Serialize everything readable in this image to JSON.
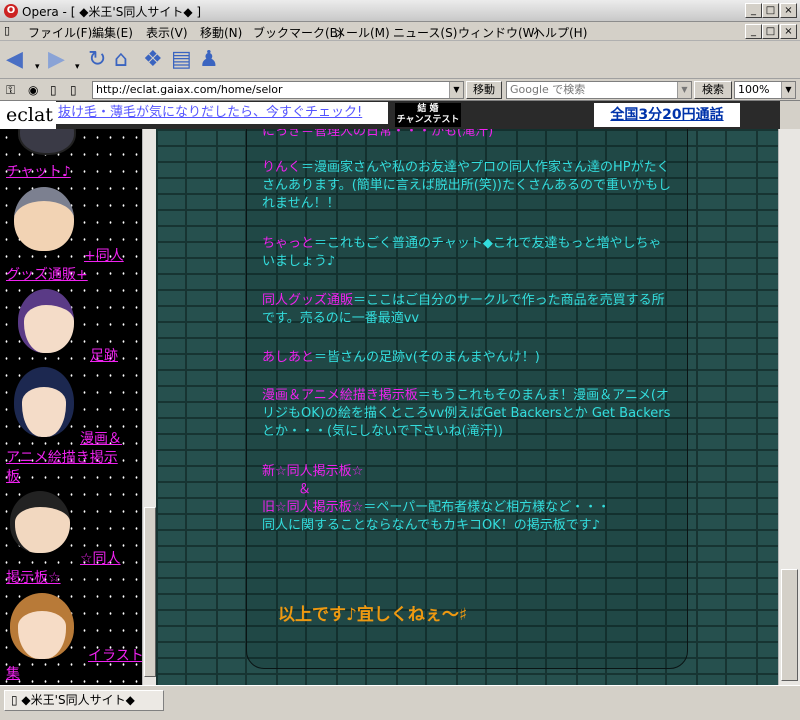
{
  "window": {
    "title": "Opera - [ ◆米王'S同人サイト◆ ]",
    "minimize": "_",
    "maximize": "□",
    "close": "×"
  },
  "menu": [
    "ファイル(F)",
    "編集(E)",
    "表示(V)",
    "移動(N)",
    "ブックマーク(B)",
    "メール(M)",
    "ニュース(S)",
    "ウィンドウ(W)",
    "ヘルプ(H)"
  ],
  "address": {
    "url": "http://eclat.gaiax.com/home/selor",
    "go_label": "移動",
    "search_placeholder": "Google で検索",
    "search_button": "検索",
    "zoom": "100%"
  },
  "ad": {
    "logo": "eclat",
    "text": "抜け毛・薄毛が気になりだしたら、今すぐチェック!",
    "badge_line1": "結  婚",
    "badge_line2": "チャンステスト",
    "call": "全国3分20円通話"
  },
  "sidebar": {
    "links": [
      "チャット♪",
      "+同人",
      "グッズ通販+",
      "足跡",
      "漫画＆",
      "アニメ絵描き掲示",
      "板",
      "☆同人",
      "掲示板☆",
      "イラスト",
      "集"
    ]
  },
  "main": {
    "cut_line": "にっき＝管理人の日常・・・かも(滝汗)",
    "paras": [
      {
        "label": "りんく",
        "text": "＝漫画家さんや私のお友達やプロの同人作家さん達のHPがたくさんあります。(簡単に言えば脱出所(笑))たくさんあるので重いかもしれません！！"
      },
      {
        "label": "ちゃっと",
        "text": "＝これもごく普通のチャット◆これで友達もっと増やしちゃいましょう♪"
      },
      {
        "label": "同人グッズ通販",
        "text": "＝ここはご自分のサークルで作った商品を売買する所です。売るのに一番最適vv"
      },
      {
        "label": "あしあと",
        "text": "＝皆さんの足跡v(そのまんまやんけ！)"
      },
      {
        "label": "漫画＆アニメ絵描き掲示板",
        "text": "＝もうこれもそのまんま！漫画＆アニメ(オリジもOK)の絵を描くところvv例えばGet Backersとか Get Backersとか・・・(気にしないで下さいね(滝汗))"
      }
    ],
    "new_board": "新☆同人掲示板☆",
    "amp": "＆",
    "old_board": "旧☆同人掲示板☆",
    "old_board_text": "＝ペーパー配布者様など相方様など・・・",
    "old_board_text2": "同人に関することならなんでもカキコOK！の掲示板です♪",
    "closing": "以上です♪宜しくねぇ～♯"
  },
  "status": {
    "tab_label": "◆米王'S同人サイト◆"
  }
}
